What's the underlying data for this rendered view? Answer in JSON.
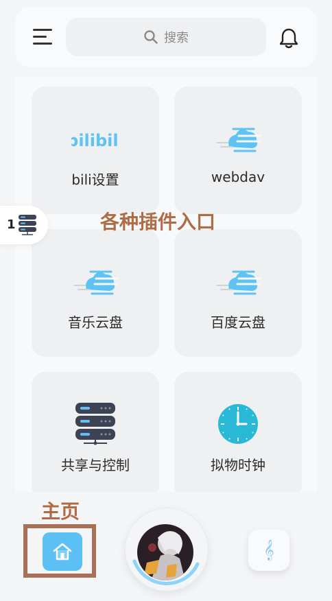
{
  "search": {
    "placeholder": "搜索"
  },
  "cards": [
    {
      "label": "bili设置",
      "icon": "bilibili-logo-icon",
      "logo_text": "bilibili"
    },
    {
      "label": "webdav",
      "icon": "cloud-speed-icon"
    },
    {
      "label": "音乐云盘",
      "icon": "cloud-speed-icon"
    },
    {
      "label": "百度云盘",
      "icon": "cloud-speed-icon"
    },
    {
      "label": "共享与控制",
      "icon": "server-stack-icon"
    },
    {
      "label": "拟物时钟",
      "icon": "clock-icon"
    }
  ],
  "annotations": {
    "plugins": "各种插件入口",
    "home": "主页"
  },
  "side_tab": {
    "number": "1",
    "icon": "server-icon"
  },
  "nav": {
    "home_icon": "home-icon",
    "music_icon": "music-note-icon",
    "music_glyph": "𝄞"
  },
  "colors": {
    "accent": "#5dc0f5",
    "annotation": "#b06d45",
    "card_bg": "#eff0f2"
  }
}
